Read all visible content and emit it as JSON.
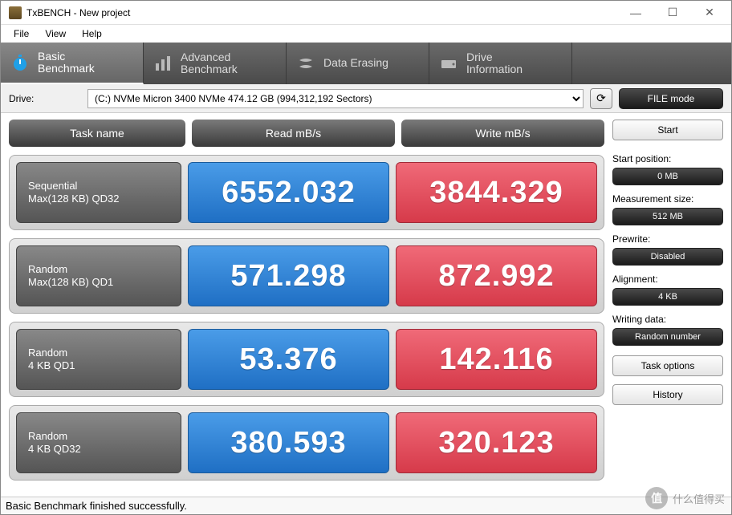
{
  "title": "TxBENCH - New project",
  "menu": {
    "file": "File",
    "view": "View",
    "help": "Help"
  },
  "tabs": [
    {
      "label": "Basic\nBenchmark",
      "active": true
    },
    {
      "label": "Advanced\nBenchmark",
      "active": false
    },
    {
      "label": "Data Erasing",
      "active": false
    },
    {
      "label": "Drive\nInformation",
      "active": false
    }
  ],
  "drive": {
    "label": "Drive:",
    "selected": "(C:) NVMe Micron 3400 NVMe  474.12 GB (994,312,192 Sectors)",
    "mode_btn": "FILE mode"
  },
  "headers": {
    "task": "Task name",
    "read": "Read mB/s",
    "write": "Write mB/s"
  },
  "rows": [
    {
      "name1": "Sequential",
      "name2": "Max(128 KB) QD32",
      "read": "6552.032",
      "write": "3844.329"
    },
    {
      "name1": "Random",
      "name2": "Max(128 KB) QD1",
      "read": "571.298",
      "write": "872.992"
    },
    {
      "name1": "Random",
      "name2": "4 KB QD1",
      "read": "53.376",
      "write": "142.116"
    },
    {
      "name1": "Random",
      "name2": "4 KB QD32",
      "read": "380.593",
      "write": "320.123"
    }
  ],
  "side": {
    "start": "Start",
    "start_pos_label": "Start position:",
    "start_pos": "0 MB",
    "meas_label": "Measurement size:",
    "meas": "512 MB",
    "prewrite_label": "Prewrite:",
    "prewrite": "Disabled",
    "align_label": "Alignment:",
    "align": "4 KB",
    "writedata_label": "Writing data:",
    "writedata": "Random number",
    "task_options": "Task options",
    "history": "History"
  },
  "status": "Basic Benchmark finished successfully.",
  "watermark": "什么值得买",
  "chart_data": {
    "type": "table",
    "title": "TxBENCH Basic Benchmark",
    "columns": [
      "Task name",
      "Read mB/s",
      "Write mB/s"
    ],
    "rows": [
      [
        "Sequential Max(128 KB) QD32",
        6552.032,
        3844.329
      ],
      [
        "Random Max(128 KB) QD1",
        571.298,
        872.992
      ],
      [
        "Random 4 KB QD1",
        53.376,
        142.116
      ],
      [
        "Random 4 KB QD32",
        380.593,
        320.123
      ]
    ]
  }
}
